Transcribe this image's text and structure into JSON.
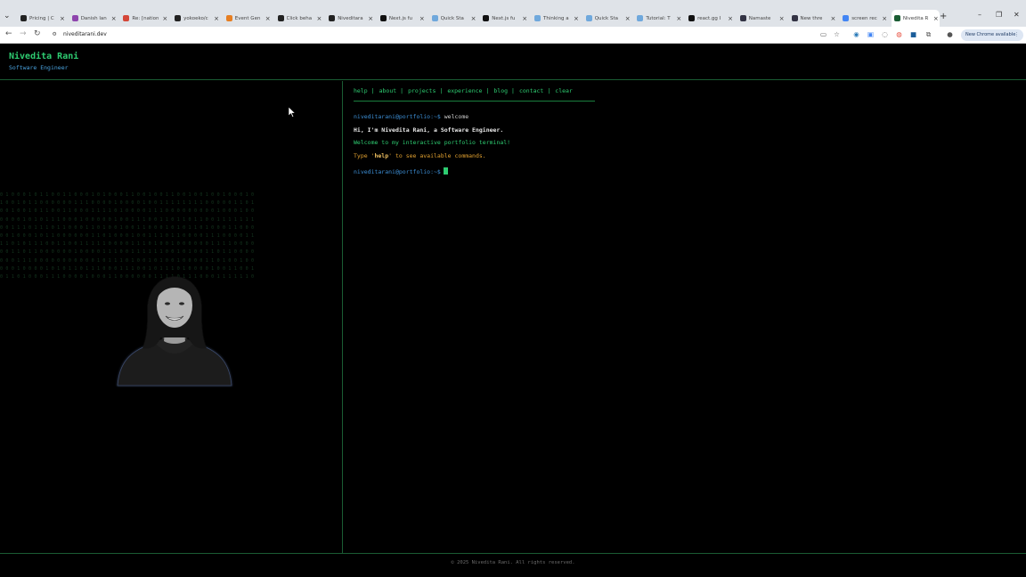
{
  "browser": {
    "tabs": [
      {
        "title": "Pricing | C",
        "color": "#222"
      },
      {
        "title": "Danish lan",
        "color": "#8e44ad"
      },
      {
        "title": "Re: [nation",
        "color": "#d44638"
      },
      {
        "title": "yokoeko/c",
        "color": "#222"
      },
      {
        "title": "Event Gen",
        "color": "#e67e22"
      },
      {
        "title": "Click beha",
        "color": "#222"
      },
      {
        "title": "Niveditara",
        "color": "#222"
      },
      {
        "title": "Next.js fu",
        "color": "#111"
      },
      {
        "title": "Quick Sta",
        "color": "#6fa8dc"
      },
      {
        "title": "Next.js fu",
        "color": "#111"
      },
      {
        "title": "Thinking a",
        "color": "#6fa8dc"
      },
      {
        "title": "Quick Sta",
        "color": "#6fa8dc"
      },
      {
        "title": "Tutorial: T",
        "color": "#6fa8dc"
      },
      {
        "title": "react.gg I",
        "color": "#111"
      },
      {
        "title": "Namaste",
        "color": "#334"
      },
      {
        "title": "New thre",
        "color": "#334"
      },
      {
        "title": "screen rec",
        "color": "#4285f4"
      },
      {
        "title": "Nivedita R",
        "color": "#1a5c33"
      }
    ],
    "url": "niveditarani.dev",
    "update_label": "New Chrome available"
  },
  "header": {
    "name": "Nivedita Rani",
    "role": "Software Engineer"
  },
  "nav": {
    "items": [
      "help",
      "about",
      "projects",
      "experience",
      "blog",
      "contact",
      "clear"
    ]
  },
  "terminal": {
    "prompt": "niveditarani@portfolio:~$",
    "command": "welcome",
    "intro": "Hi, I'm Nivedita Rani, a Software Engineer.",
    "welcome": "Welcome to my interactive portfolio terminal!",
    "hint_pre": "Type '",
    "hint_cmd": "help",
    "hint_post": "' to see available commands."
  },
  "footer": {
    "text": "© 2025 Nivedita Rani. All rights reserved."
  },
  "colors": {
    "accent": "#2ecc71",
    "prompt": "#3d8fd6",
    "hint": "#e0a030",
    "background": "#000000"
  }
}
